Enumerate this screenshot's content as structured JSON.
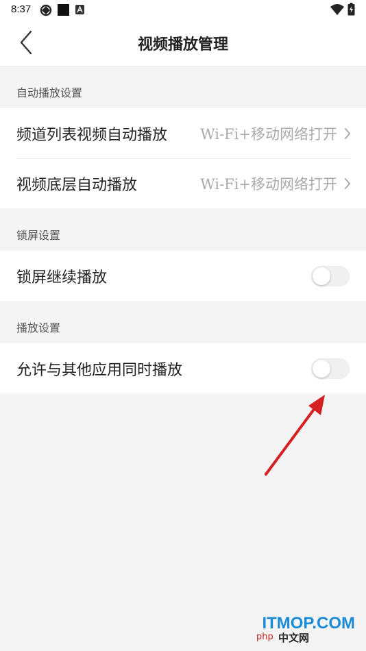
{
  "status_bar": {
    "time": "8:37",
    "icons": [
      "sync-icon",
      "square-icon",
      "a-badge-icon",
      "wifi-icon",
      "battery-icon"
    ]
  },
  "header": {
    "title": "视频播放管理",
    "back_icon": "chevron-left-icon"
  },
  "sections": [
    {
      "header": "自动播放设置",
      "rows": [
        {
          "label": "频道列表视频自动播放",
          "value": "Wi-Fi+移动网络打开"
        },
        {
          "label": "视频底层自动播放",
          "value": "Wi-Fi+移动网络打开"
        }
      ]
    },
    {
      "header": "锁屏设置",
      "rows": [
        {
          "label": "锁屏继续播放",
          "toggle_on": false
        }
      ]
    },
    {
      "header": "播放设置",
      "rows": [
        {
          "label": "允许与其他应用同时播放",
          "toggle_on": false
        }
      ]
    }
  ],
  "annotation": {
    "arrow_color": "#d42020"
  },
  "watermark": {
    "main": "ITMOP.COM",
    "sub_left": "php",
    "sub_right": "中文网"
  },
  "colors": {
    "background": "#f4f4f4",
    "card": "#ffffff",
    "secondary_text": "#aaaaaa",
    "watermark_blue": "#1a8bd6"
  }
}
